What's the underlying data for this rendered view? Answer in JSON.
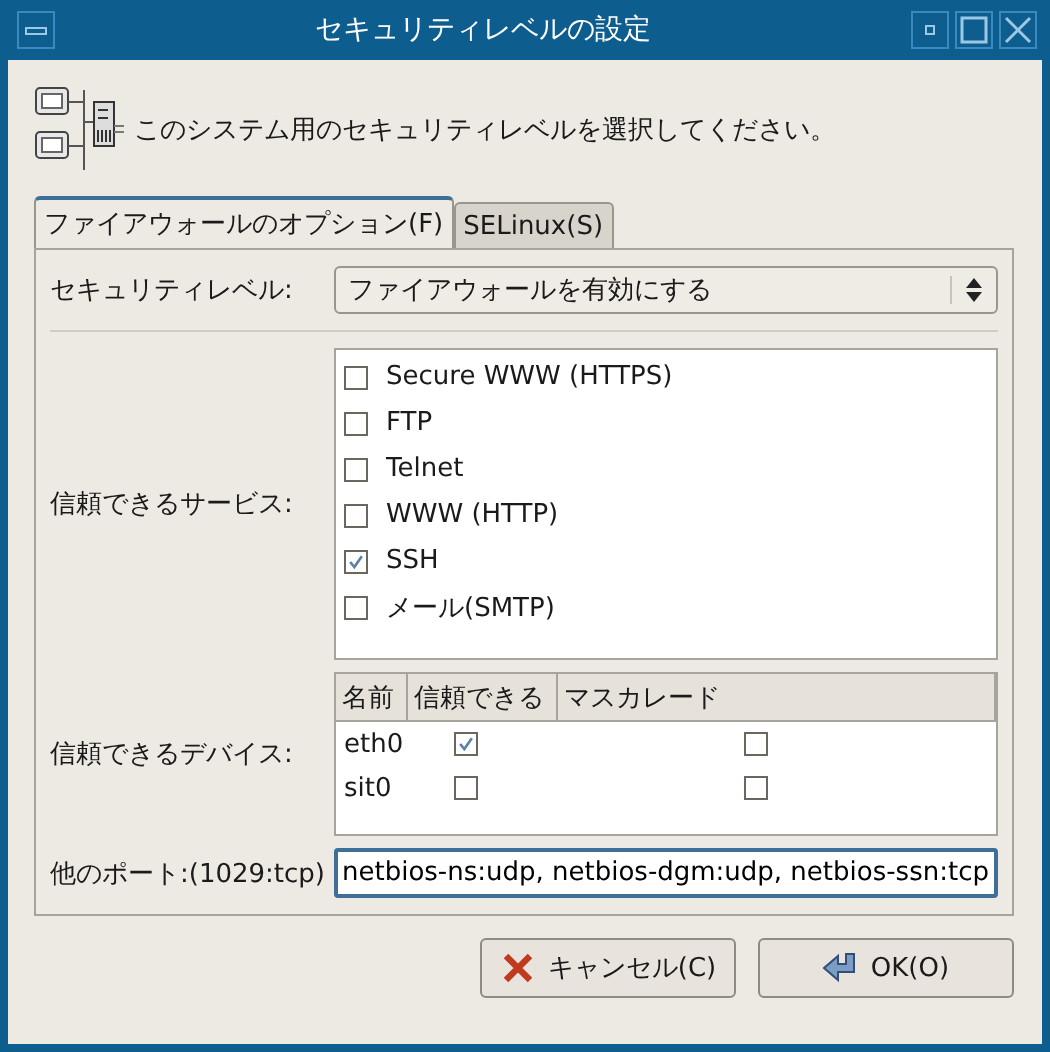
{
  "window": {
    "title": "セキュリティレベルの設定"
  },
  "header": {
    "text": "このシステム用のセキュリティレベルを選択してください。"
  },
  "tabs": [
    {
      "label": "ファイアウォールのオプション(F)",
      "selected": true
    },
    {
      "label": "SELinux(S)",
      "selected": false
    }
  ],
  "security_level": {
    "label": "セキュリティレベル:",
    "value": "ファイアウォールを有効にする"
  },
  "services": {
    "label": "信頼できるサービス:",
    "items": [
      {
        "label": "Secure WWW (HTTPS)",
        "checked": false
      },
      {
        "label": "FTP",
        "checked": false
      },
      {
        "label": "Telnet",
        "checked": false
      },
      {
        "label": "WWW (HTTP)",
        "checked": false
      },
      {
        "label": "SSH",
        "checked": true
      },
      {
        "label": "メール(SMTP)",
        "checked": false
      }
    ]
  },
  "devices": {
    "label": "信頼できるデバイス:",
    "columns": [
      "名前",
      "信頼できる",
      "マスカレード"
    ],
    "rows": [
      {
        "name": "eth0",
        "trusted": true,
        "masquerade": false
      },
      {
        "name": "sit0",
        "trusted": false,
        "masquerade": false
      }
    ]
  },
  "other_ports": {
    "label": "他のポート:(1029:tcp)",
    "value": "netbios-ns:udp, netbios-dgm:udp, netbios-ssn:tcp"
  },
  "buttons": [
    {
      "label": "キャンセル(C)",
      "kind": "cancel"
    },
    {
      "label": "OK(O)",
      "kind": "ok"
    }
  ]
}
